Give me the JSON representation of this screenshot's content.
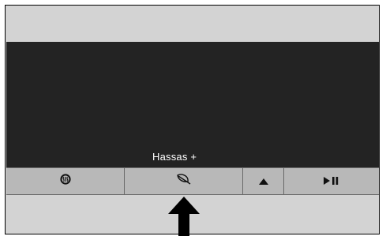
{
  "display": {
    "mode_label": "Hassas +"
  },
  "buttons": [
    {
      "icon": "defrost-heat-icon"
    },
    {
      "icon": "leaf-eco-icon"
    },
    {
      "icon": "up-triangle-icon"
    },
    {
      "icon": "play-pause-icon"
    }
  ],
  "colors": {
    "frame_bg": "#d3d3d3",
    "screen_bg": "#232323",
    "button_bar_bg": "#b8b8b8",
    "label_text": "#ffffff"
  }
}
